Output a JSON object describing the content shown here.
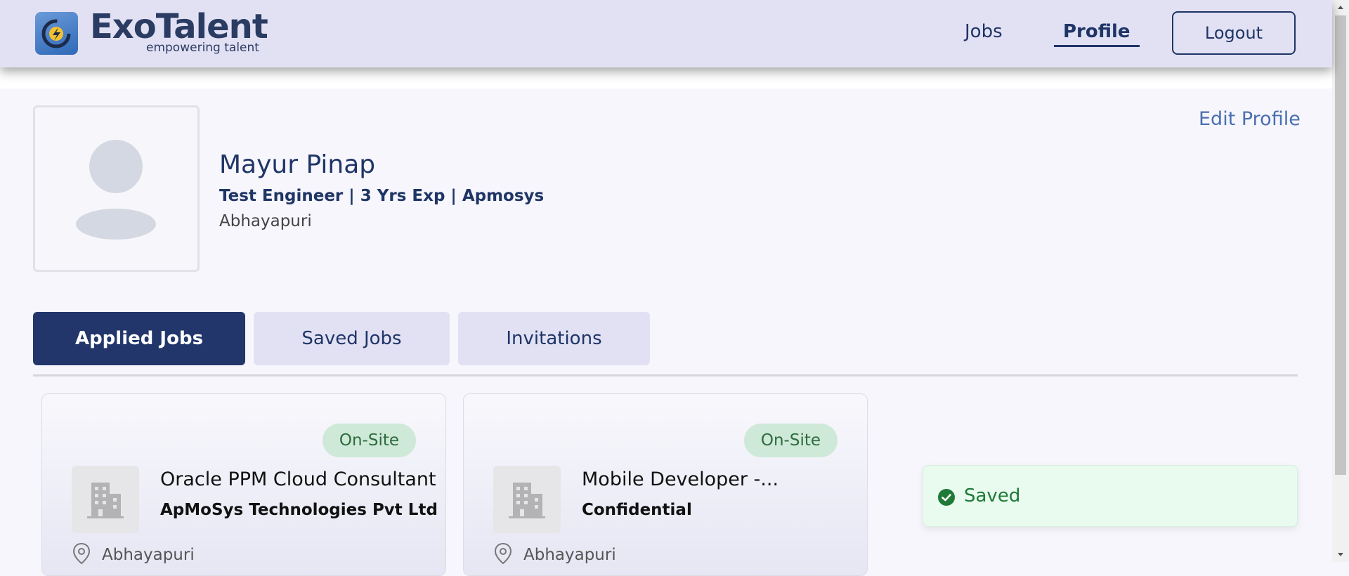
{
  "brand": {
    "name": "ExoTalent",
    "tagline": "empowering talent"
  },
  "nav": {
    "jobs_label": "Jobs",
    "profile_label": "Profile",
    "logout_label": "Logout",
    "active": "Profile"
  },
  "profile": {
    "name": "Mayur Pinap",
    "subtitle": "Test Engineer | 3 Yrs Exp | Apmosys",
    "location": "Abhayapuri",
    "edit_label": "Edit Profile"
  },
  "tabs": [
    {
      "label": "Applied Jobs",
      "active": true
    },
    {
      "label": "Saved Jobs",
      "active": false
    },
    {
      "label": "Invitations",
      "active": false
    }
  ],
  "jobs": [
    {
      "badge": "On-Site",
      "title": "Oracle PPM Cloud Consultant",
      "company": "ApMoSys Technologies Pvt Ltd",
      "location": "Abhayapuri",
      "logo_icon": "building-icon"
    },
    {
      "badge": "On-Site",
      "title": "Mobile Developer -...",
      "company": "Confidential",
      "location": "Abhayapuri",
      "logo_icon": "building-icon"
    }
  ],
  "toast": {
    "message": "Saved",
    "icon": "check-circle-icon"
  },
  "colors": {
    "navbar_bg": "#e2e1f4",
    "primary": "#22366b",
    "link": "#4a6fb0",
    "badge_bg": "#cfe9d8",
    "success": "#1e7a36"
  }
}
